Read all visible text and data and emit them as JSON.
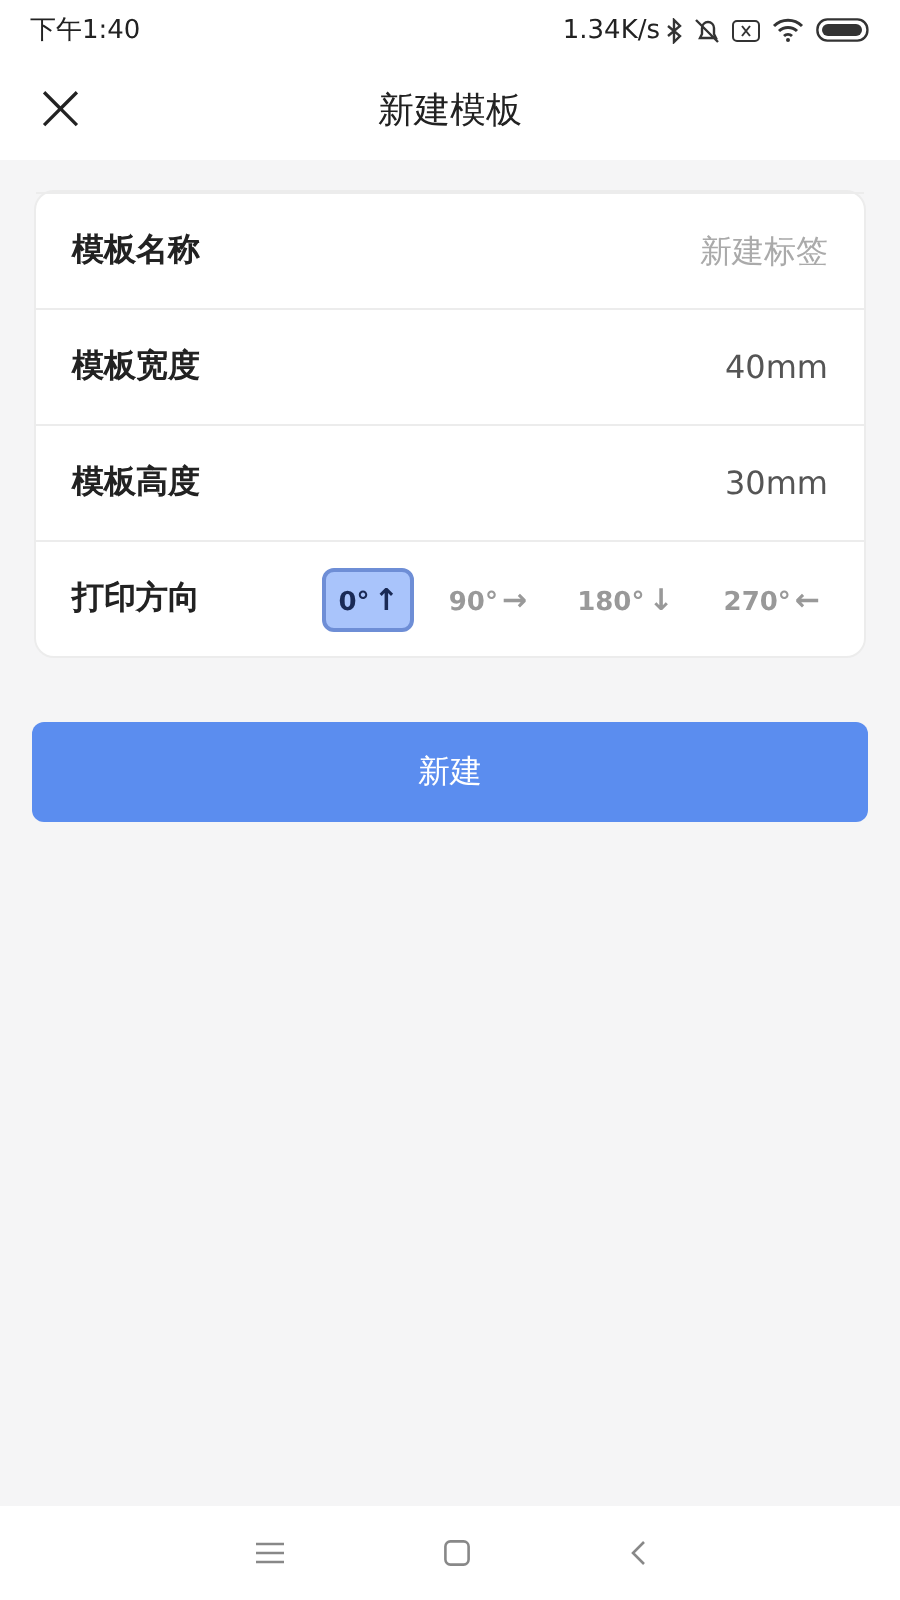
{
  "status_bar": {
    "time": "下午1:40",
    "speed": "1.34K/s"
  },
  "header": {
    "close": "×",
    "title": "新建模板"
  },
  "form": {
    "rows": [
      {
        "kind": "input",
        "label": "模板名称",
        "placeholder": "新建标签"
      },
      {
        "kind": "input",
        "label": "模板宽度",
        "value": "40mm"
      },
      {
        "kind": "input",
        "label": "模板高度",
        "value": "30mm"
      },
      {
        "kind": "orientation",
        "label": "打印方向",
        "options": [
          {
            "degrees": "0°",
            "arrow": "↑",
            "selected": true
          },
          {
            "degrees": "90°",
            "arrow": "→",
            "selected": false
          },
          {
            "degrees": "180°",
            "arrow": "↓",
            "selected": false
          },
          {
            "degrees": "270°",
            "arrow": "←",
            "selected": false
          }
        ]
      }
    ]
  },
  "submit": {
    "label": "新建"
  }
}
